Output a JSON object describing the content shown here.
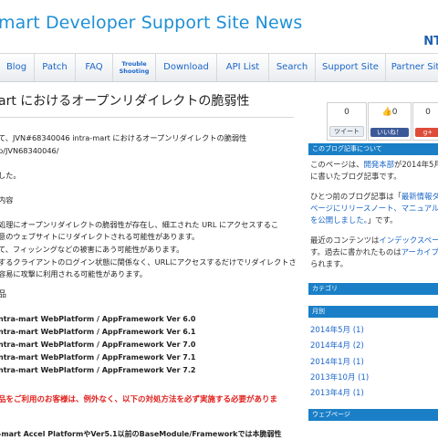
{
  "header": {
    "title": "mart Developer Support Site News",
    "brand": "NT"
  },
  "nav": {
    "items": [
      "Blog",
      "Patch",
      "FAQ",
      "Trouble Shooting",
      "Download",
      "API List",
      "Search",
      "Support Site",
      "Partner Sit"
    ]
  },
  "article": {
    "title": "art におけるオープンリダイレクトの脆弱性",
    "lines": [
      "て、JVN#68340046 intra-mart におけるオープンリダイレクトの脆弱性",
      "p/JVN68340046/",
      "した。",
      "内容",
      "処理にオープンリダイレクトの脆弱性が存在し、細工された URL にアクセスするこ",
      "意のウェブサイトにリダイレクトされる可能性があります。",
      "て、フィッシングなどの被害にあう可能性があります。",
      "するクライアントのログイン状態に関係なく、URLにアクセスするだけでリダイレクトさ",
      "容易に攻撃に利用される可能性があります。",
      "品"
    ],
    "products": [
      "ntra-mart WebPlatform / AppFramework Ver 6.0",
      "ntra-mart WebPlatform / AppFramework Ver 6.1",
      "ntra-mart WebPlatform / AppFramework Ver 7.0",
      "ntra-mart WebPlatform / AppFramework Ver 7.1",
      "ntra-mart WebPlatform / AppFramework Ver 7.2"
    ],
    "warning": "品をご利用のお客様は、例外なく、以下の対処方法を必ず実施する必要がありま",
    "footer_line": "-mart Accel PlatformやVer5.1以前のBaseModule/Frameworkでは本脆弱性"
  },
  "social": {
    "tweet_count": "0",
    "tweet_label": "ツイート",
    "like_count": "0",
    "like_label": "いいね！",
    "plus_count": "0"
  },
  "sidebar": {
    "about_head": "このブログ記事について",
    "about_l1a": "このページは、",
    "about_l1b": "開発本部",
    "about_l1c": "が2014年5月",
    "about_l2": "に書いたブログ記事です。",
    "prev_l1a": "ひとつ前のブログ記事は「",
    "prev_l1b": "最新情報ダ",
    "prev_l2": "ページにリリースノート、マニュアル系",
    "prev_l3a": "を公開しました。",
    "prev_l3b": "」です。",
    "recent_l1a": "最近のコンテンツは",
    "recent_l1b": "インデックスペー",
    "recent_l2a": "す。過去に書かれたものは",
    "recent_l2b": "アーカイブ",
    "recent_l3": "られます。",
    "category_head": "カテゴリ",
    "monthly_head": "月別",
    "months": [
      "2014年5月 (1)",
      "2014年4月 (2)",
      "2014年1月 (1)",
      "2013年10月 (1)",
      "2013年4月 (1)"
    ],
    "web_head": "ウェブページ"
  },
  "colors": {
    "accent": "#1a7fc7",
    "title": "#1e90d6",
    "link": "#1b66c9",
    "warning": "#e0201c"
  }
}
